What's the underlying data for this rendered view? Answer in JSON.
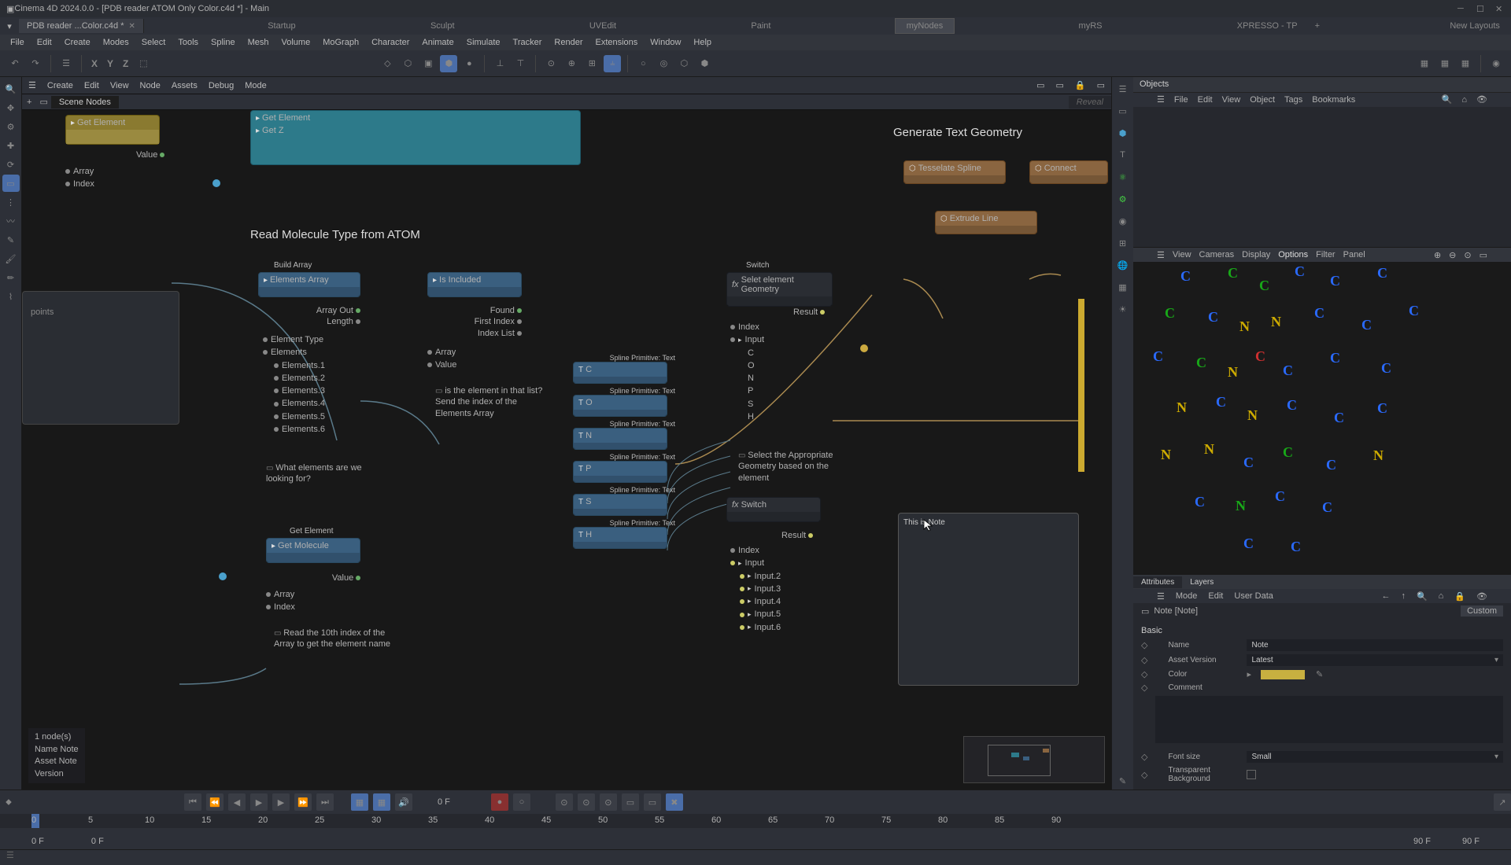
{
  "title": "Cinema 4D 2024.0.0 - [PDB reader ATOM Only Color.c4d *] - Main",
  "tab_name": "PDB reader ...Color.c4d *",
  "top_tabs": [
    "Startup",
    "Sculpt",
    "UVEdit",
    "Paint",
    "myNodes",
    "myRS",
    "XPRESSO - TP",
    "New Layouts"
  ],
  "top_tabs_active": "myNodes",
  "menu": [
    "File",
    "Edit",
    "Create",
    "Modes",
    "Select",
    "Tools",
    "Spline",
    "Mesh",
    "Volume",
    "MoGraph",
    "Character",
    "Animate",
    "Simulate",
    "Tracker",
    "Render",
    "Extensions",
    "Window",
    "Help"
  ],
  "axis": [
    "X",
    "Y",
    "Z"
  ],
  "node_menu": [
    "Create",
    "Edit",
    "View",
    "Node",
    "Assets",
    "Debug",
    "Mode"
  ],
  "scene_tab": "Scene Nodes",
  "reveal": "Reveal",
  "points_label": "points",
  "grp_read": "Read Molecule Type from ATOM",
  "grp_gen": "Generate Text Geometry",
  "nodes": {
    "get_element_top": "Get Element",
    "get_element2": "Get Element",
    "get_z": "Get Z",
    "array1": "Array",
    "index1": "Index",
    "value1": "Value",
    "build_array": "Build Array",
    "elements_array": "Elements Array",
    "array_out": "Array Out",
    "length": "Length",
    "element_type": "Element Type",
    "elements": "Elements",
    "el1": "Elements.1",
    "el2": "Elements.2",
    "el3": "Elements.3",
    "el4": "Elements.4",
    "el5": "Elements.5",
    "el6": "Elements.6",
    "is_included": "Is Included",
    "found": "Found",
    "first_index": "First Index",
    "index_list": "Index List",
    "arr_port": "Array",
    "val_port": "Value",
    "get_element3": "Get Element",
    "get_molecule": "Get Molecule",
    "value2": "Value",
    "array2": "Array",
    "index2": "Index",
    "spline_c": "Spline Primitive: Text",
    "sc": "C",
    "spline_o": "Spline Primitive: Text",
    "so": "O",
    "spline_n": "Spline Primitive: Text",
    "sn": "N",
    "spline_p": "Spline Primitive: Text",
    "sp": "P",
    "spline_s": "Spline Primitive: Text",
    "ss": "S",
    "spline_h": "Spline Primitive: Text",
    "sh": "H",
    "switch1_t": "Switch",
    "switch1_sub": "Selet element Geometry",
    "result1": "Result",
    "idx1": "Index",
    "inp1": "Input",
    "lC": "C",
    "lO": "O",
    "lN": "N",
    "lP": "P",
    "lS": "S",
    "lH": "H",
    "switch2": "Switch",
    "result2": "Result",
    "idx2": "Index",
    "inp2": "Input",
    "i2": "Input.2",
    "i3": "Input.3",
    "i4": "Input.4",
    "i5": "Input.5",
    "i6": "Input.6",
    "tess": "Tesselate Spline",
    "extrude": "Extrude Line",
    "connect": "Connect",
    "note_text": "This is Note"
  },
  "notes": {
    "n1": "is the element in that list? Send the index of the Elements Array",
    "n2": "What elements are we looking for?",
    "n3": "Read the 10th index of the Array to get the element name",
    "n4": "Select the Appropriate Geometry based on the element"
  },
  "status": {
    "l1": "1 node(s)",
    "l2": "Name    Note",
    "l3": "Asset    Note",
    "l4": "Version"
  },
  "objects_title": "Objects",
  "obj_menu": [
    "File",
    "Edit",
    "View",
    "Object",
    "Tags",
    "Bookmarks"
  ],
  "view_menu": [
    "View",
    "Cameras",
    "Display",
    "Options",
    "Filter",
    "Panel"
  ],
  "view_sel": "Options",
  "attr_tabs": [
    "Attributes",
    "Layers"
  ],
  "attr_menu": [
    "Mode",
    "Edit",
    "User Data"
  ],
  "attr_crumb": "Note [Note]",
  "attr_mode": "Custom",
  "attr": {
    "basic": "Basic",
    "name_l": "Name",
    "name_v": "Note",
    "asset_l": "Asset Version",
    "asset_v": "Latest",
    "color_l": "Color",
    "comment_l": "Comment",
    "font_l": "Font size",
    "font_v": "Small",
    "bg_l": "Transparent Background"
  },
  "tl": {
    "cur": "0 F",
    "ticks": [
      "0",
      "5",
      "10",
      "15",
      "20",
      "25",
      "30",
      "35",
      "40",
      "45",
      "50",
      "55",
      "60",
      "65",
      "70",
      "75",
      "80",
      "85",
      "90"
    ],
    "f0": "0 F",
    "f1": "0 F",
    "f90a": "90 F",
    "f90b": "90 F"
  }
}
